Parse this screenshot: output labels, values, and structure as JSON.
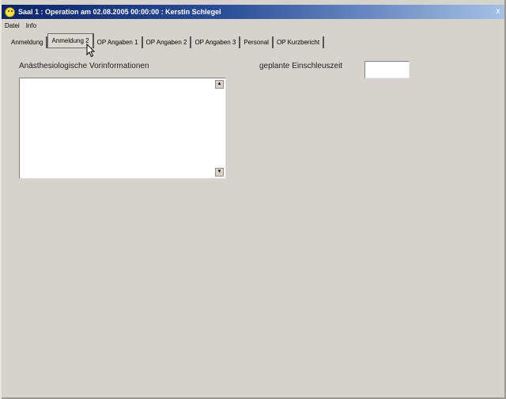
{
  "window": {
    "title": "Saal 1 : Operation am 02.08.2005 00:00:00 : Kerstin Schlegel",
    "close_glyph": "x"
  },
  "menu": [
    "Datei",
    "Info"
  ],
  "tabs": [
    {
      "label": "Anmeldung",
      "active": false
    },
    {
      "label": "Anmeldung 2",
      "active": true
    },
    {
      "label": "OP Angaben 1",
      "active": false
    },
    {
      "label": "OP Angaben 2",
      "active": false
    },
    {
      "label": "OP Angaben 3",
      "active": false
    },
    {
      "label": "Personal",
      "active": false
    },
    {
      "label": "OP Kurzbericht",
      "active": false
    }
  ],
  "form": {
    "anaesthesia_label": "Anästhesiologische Vorinformationen",
    "anaesthesia_value": "",
    "einschleus_label": "geplante Einschleuszeit",
    "einschleus_value": ""
  },
  "colors": {
    "title_bar_start": "#0a246a",
    "title_bar_end": "#a6c0e6",
    "background": "#d6d3ce"
  }
}
